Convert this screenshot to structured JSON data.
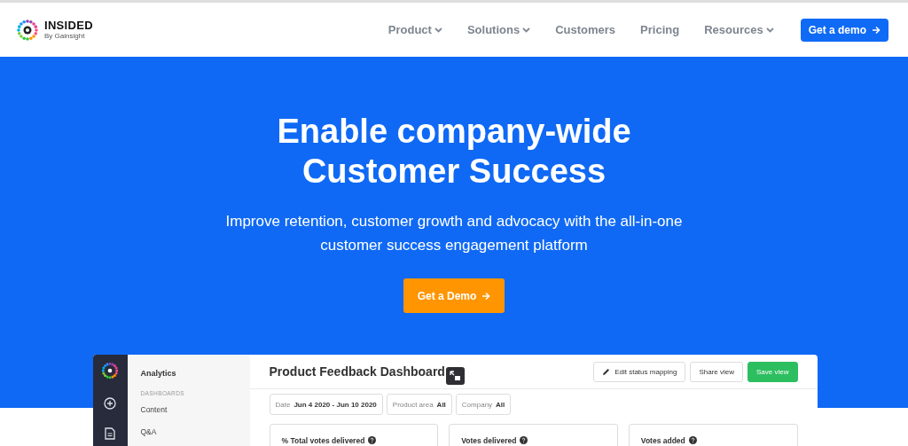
{
  "nav": {
    "logo": {
      "word": "INSIDED",
      "byline": "By Gainsight"
    },
    "items": [
      {
        "label": "Product",
        "dropdown": true
      },
      {
        "label": "Solutions",
        "dropdown": true
      },
      {
        "label": "Customers",
        "dropdown": false
      },
      {
        "label": "Pricing",
        "dropdown": false
      },
      {
        "label": "Resources",
        "dropdown": true
      }
    ],
    "cta": "Get a demo"
  },
  "hero": {
    "title_lines": [
      "Enable company-wide",
      "Customer Success"
    ],
    "subtitle_lines": [
      "Improve retention, customer growth and advocacy with the all-in-one",
      "customer success engagement platform"
    ],
    "button": "Get a Demo"
  },
  "dashboard": {
    "sidebar": {
      "heading": "Analytics",
      "section": "DASHBOARDS",
      "items": [
        "Content",
        "Q&A"
      ]
    },
    "title": "Product Feedback Dashboard",
    "actions": [
      {
        "label": "Edit status mapping",
        "kind": "edit"
      },
      {
        "label": "Share view",
        "kind": "plain"
      },
      {
        "label": "Save view",
        "kind": "primary"
      }
    ],
    "filters": [
      {
        "label": "Date",
        "value": "Jun 4 2020 - Jun 10 2020"
      },
      {
        "label": "Product area",
        "value": "All"
      },
      {
        "label": "Company",
        "value": "All"
      }
    ],
    "cards": [
      "% Total votes delivered",
      "Votes delivered",
      "Votes added"
    ]
  }
}
